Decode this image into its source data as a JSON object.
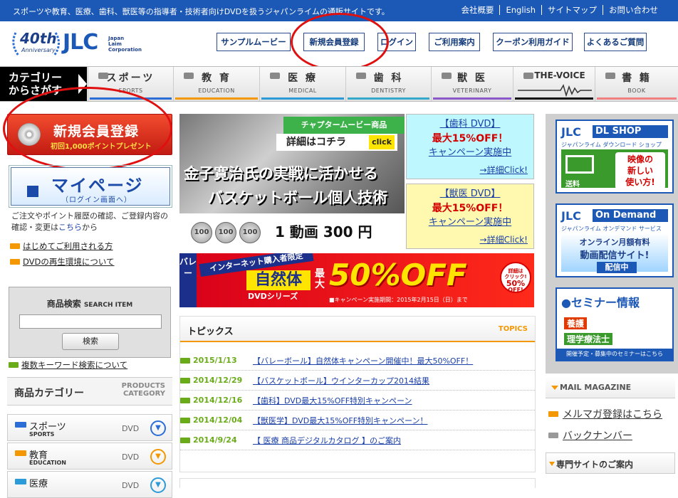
{
  "topbar": {
    "tagline": "スポーツや教育、医療、歯科、獣医等の指導者・技術者向けDVDを扱うジャパンライムの通販サイトです。",
    "links": [
      "会社概要",
      "English",
      "サイトマップ",
      "お問い合わせ"
    ]
  },
  "logo": {
    "anniversary": "40th",
    "anniversary_sub": "Anniversary",
    "brand": "JLC",
    "company_line1": "Japan",
    "company_line2": "Laim",
    "company_line3": "Corporation"
  },
  "header_nav": [
    "サンプルムービー",
    "新規会員登録",
    "ログイン",
    "ご利用案内",
    "クーポン利用ガイド",
    "よくあるご質問"
  ],
  "category_bar": {
    "label_line1": "カテゴリー",
    "label_line2": "からさがす",
    "items": [
      {
        "jp": "スポーツ",
        "en": "SPORTS",
        "color": "#2b6ed8"
      },
      {
        "jp": "教 育",
        "en": "EDUCATION",
        "color": "#f39800"
      },
      {
        "jp": "医 療",
        "en": "MEDICAL",
        "color": "#2b9ad8"
      },
      {
        "jp": "歯 科",
        "en": "DENTISTRY",
        "color": "#33a8c8"
      },
      {
        "jp": "獣 医",
        "en": "VETERINARY",
        "color": "#8a58c8"
      },
      {
        "jp": "THE-VOICE",
        "en": "",
        "color": "#111111"
      },
      {
        "jp": "書 籍",
        "en": "BOOK",
        "color": "#f08080"
      }
    ]
  },
  "register_button": {
    "label": "新規会員登録",
    "sub": "初回1,000ポイントプレゼント"
  },
  "mypage": {
    "label": "マイページ",
    "sub": "（ログイン画面へ）"
  },
  "mypage_desc": {
    "before": "ご注文やポイント履歴の確認、ご登録内容の確認・変更は",
    "link": "こちら",
    "after": "から"
  },
  "member_links": [
    "はじめてご利用される方",
    "DVDの再生環境について"
  ],
  "search": {
    "title": "商品検索",
    "title_en": "SEARCH ITEM",
    "button": "検索",
    "value": "",
    "note_link": "複数キーワード検索について"
  },
  "product_category": {
    "title": "商品カテゴリー",
    "title_en_line1": "PRODUCTS",
    "title_en_line2": "CATEGORY",
    "items": [
      {
        "jp": "スポーツ",
        "en": "SPORTS",
        "dvd": "DVD",
        "color": "#2b6ed8"
      },
      {
        "jp": "教育",
        "en": "EDUCATION",
        "dvd": "DVD",
        "color": "#f39800"
      },
      {
        "jp": "医療",
        "en": "",
        "dvd": "DVD",
        "color": "#2b9ad8"
      }
    ]
  },
  "main_banner": {
    "chapter": "チャプタームービー商品",
    "detail": "詳細はコチラ",
    "click": "click",
    "headline1": "金子寛治氏の実戦に活かせる",
    "headline2": "バスケットボール個人技術",
    "coin": "100",
    "price": "1 動画 300 円"
  },
  "promo_boxes": [
    {
      "title": "【歯科 DVD】",
      "offer": "最大15%OFF！",
      "campaign": "キャンペーン実施中",
      "detail": "→詳細Click!",
      "bg": "#bff7ff"
    },
    {
      "title": "【獣医 DVD】",
      "offer": "最大15%OFF！",
      "campaign": "キャンペーン実施中",
      "detail": "→詳細Click!",
      "bg": "#fff9b0"
    }
  ],
  "volley_banner": {
    "vertical": "バレー",
    "band": "インターネット購入者限定",
    "yellow": "自然体",
    "series": "DVDシリーズ",
    "max": "最大",
    "percent": "50%OFF",
    "period": "■キャンペーン実施期間：2015年2月15日（日）まで",
    "circle_line1": "詳細は",
    "circle_line2": "クリック!",
    "circle_line3": "50%",
    "circle_line4": "OFF!"
  },
  "topics": {
    "title": "トピックス",
    "title_en": "TOPICS",
    "items": [
      {
        "date": "2015/1/13",
        "text": "【バレーボール】自然体キャンペーン開催中！最大50%OFF！"
      },
      {
        "date": "2014/12/29",
        "text": "【バスケットボール】ウインターカップ2014結果"
      },
      {
        "date": "2014/12/16",
        "text": "【歯科】DVD最大15%OFF特別キャンペーン"
      },
      {
        "date": "2014/12/04",
        "text": "【獣医学】DVD最大15%OFF特別キャンペーン！"
      },
      {
        "date": "2014/9/24",
        "text": "【 医療 商品デジタルカタログ 】のご案内"
      }
    ]
  },
  "right_banners": {
    "dl": {
      "brand": "JLC",
      "title": "DL SHOP",
      "sub": "ジャパンライム ダウンロード ショップ",
      "body1": "映像の",
      "body2": "新しい",
      "body3": "使い方!",
      "icon_label": "送料"
    },
    "od": {
      "brand": "JLC",
      "title": "On Demand",
      "sub": "ジャパンライム オンデマンド サービス",
      "body1": "オンライン月額有料",
      "body2": "動画配信サイト!",
      "badge": "配信中"
    },
    "seminar": {
      "title": "●セミナー情報",
      "tag1": "養護",
      "tag2": "理学療法士",
      "foot": "開催予定・募集中のセミナーはこちら"
    }
  },
  "mail_magazine": {
    "title": "MAIL MAGAZINE",
    "links": [
      "メルマガ登録はこちら",
      "バックナンバー"
    ]
  },
  "specialty": {
    "title": "専門サイトのご案内"
  },
  "colors": {
    "topbar": "#1c58b5",
    "accent": "#f39800",
    "red": "#d40000",
    "link": "#1a3fa6",
    "green": "#6aab1a"
  }
}
